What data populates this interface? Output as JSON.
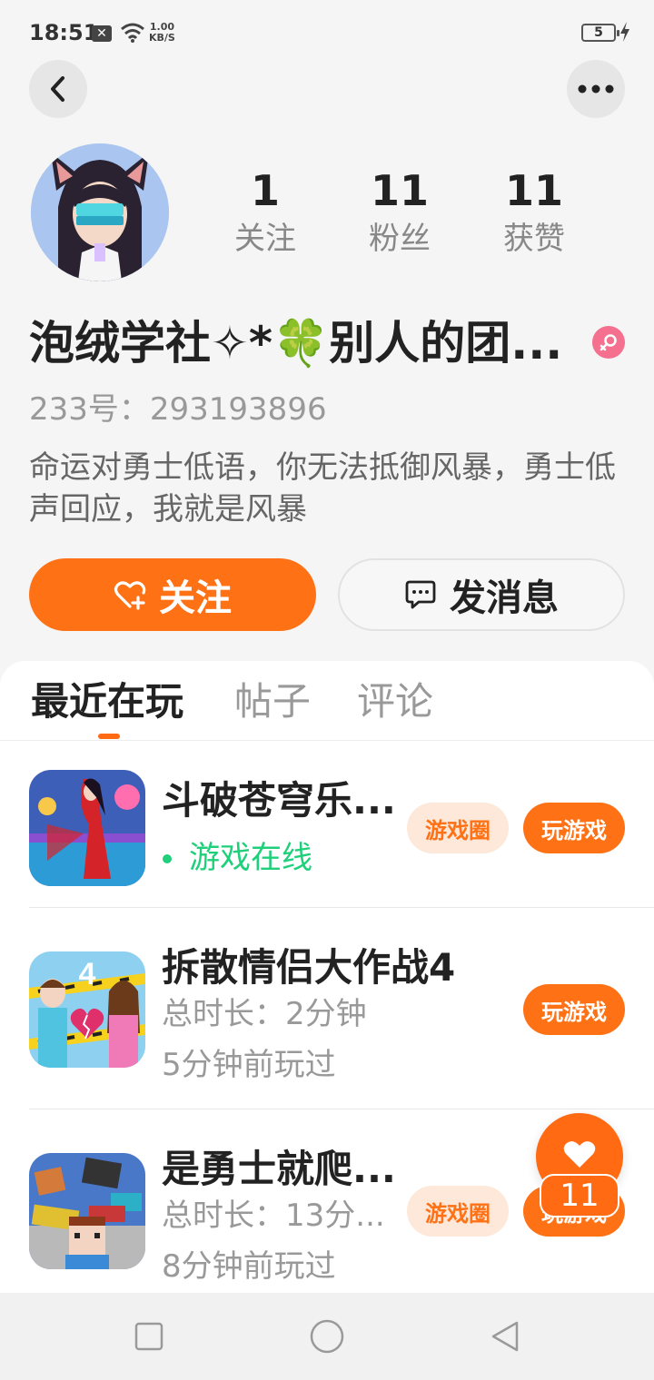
{
  "status_bar": {
    "time": "18:51",
    "speed_value": "1.00",
    "speed_unit": "KB/S",
    "battery": "5",
    "icons": [
      "notification-x-icon",
      "wifi-icon",
      "battery-icon",
      "charging-bolt-icon"
    ]
  },
  "nav": {
    "back_icon": "back-arrow-icon",
    "more_icon": "more-dots-icon"
  },
  "profile": {
    "stats": [
      {
        "value": "1",
        "label": "关注"
      },
      {
        "value": "11",
        "label": "粉丝"
      },
      {
        "value": "11",
        "label": "获赞"
      }
    ],
    "username": "泡绒学社✧*🍀别人的团...",
    "gender_icon": "female-icon",
    "uid": "233号：293193896",
    "bio": "命运对勇士低语，你无法抵御风暴，勇士低声回应，我就是风暴",
    "follow_button": "关注",
    "message_button": "发消息"
  },
  "tabs": [
    {
      "label": "最近在玩",
      "active": true
    },
    {
      "label": "帖子",
      "active": false
    },
    {
      "label": "评论",
      "active": false
    }
  ],
  "games": [
    {
      "title": "斗破苍穹乐...",
      "status": "游戏在线",
      "circle_label": "游戏圈",
      "play_label": "玩游戏"
    },
    {
      "title": "拆散情侣大作战4",
      "duration": "总时长：2分钟",
      "last_played": "5分钟前玩过",
      "play_label": "玩游戏",
      "icon_badge": "4"
    },
    {
      "title": "是勇士就爬...",
      "duration": "总时长：13分...",
      "last_played": "8分钟前玩过",
      "circle_label": "游戏圈",
      "play_label": "玩游戏"
    }
  ],
  "floating_like": {
    "count": "11"
  },
  "colors": {
    "accent": "#ff7115",
    "online": "#1fcf7a",
    "gender": "#f4708e"
  }
}
